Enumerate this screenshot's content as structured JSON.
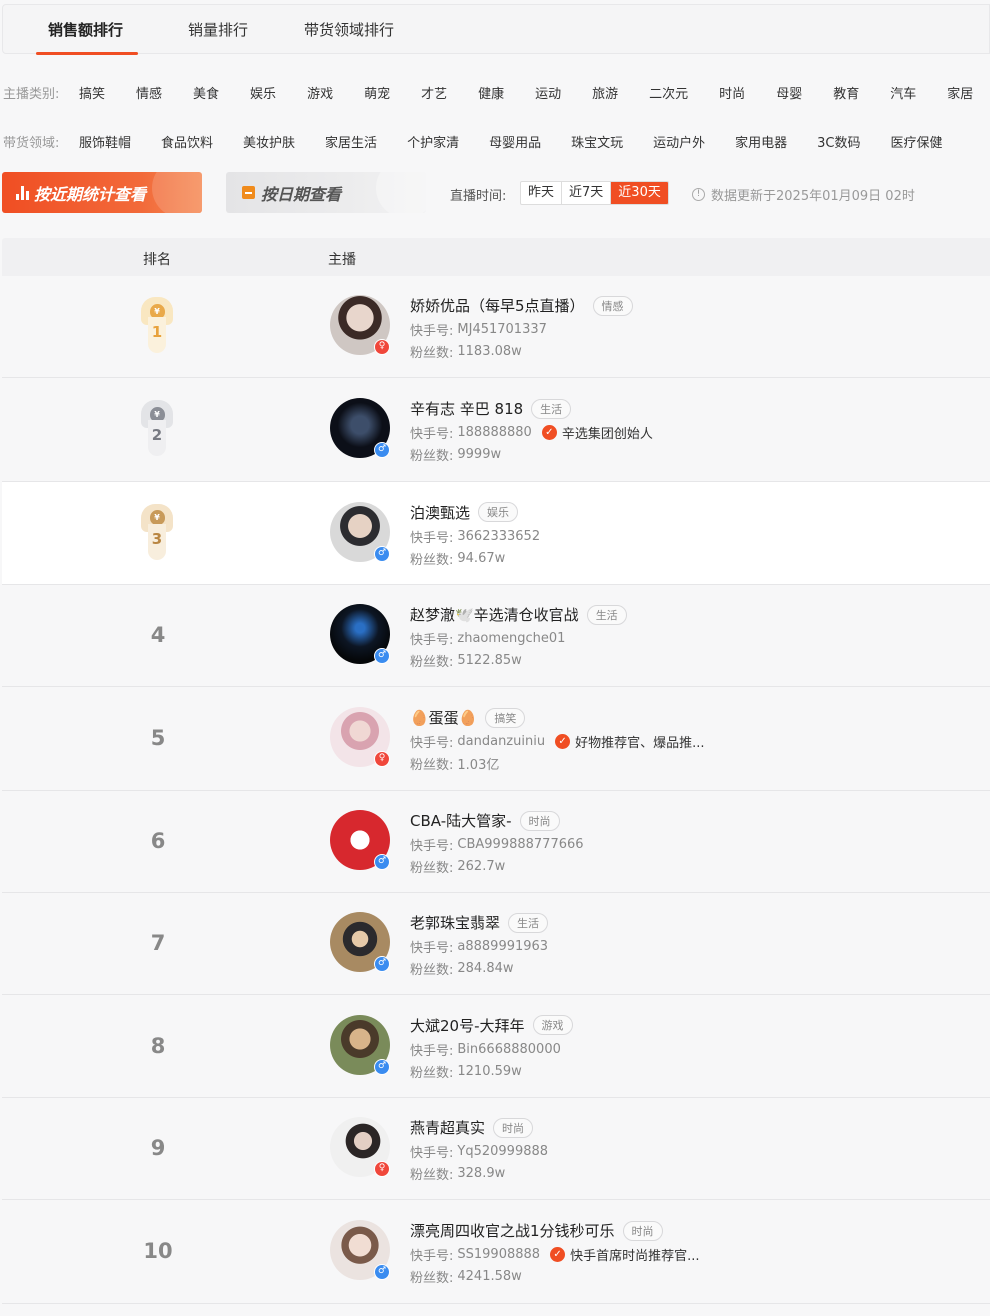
{
  "tabs": [
    "销售额排行",
    "销量排行",
    "带货领域排行"
  ],
  "filters": {
    "category_label": "主播类别:",
    "categories": [
      "搞笑",
      "情感",
      "美食",
      "娱乐",
      "游戏",
      "萌宠",
      "才艺",
      "健康",
      "运动",
      "旅游",
      "二次元",
      "时尚",
      "母婴",
      "教育",
      "汽车",
      "家居"
    ],
    "domain_label": "带货领域:",
    "domains": [
      "服饰鞋帽",
      "食品饮料",
      "美妆护肤",
      "家居生活",
      "个护家清",
      "母婴用品",
      "珠宝文玩",
      "运动户外",
      "家用电器",
      "3C数码",
      "医疗保健"
    ]
  },
  "toolbar": {
    "recent_btn": "按近期统计查看",
    "date_btn": "按日期查看",
    "time_label": "直播时间:",
    "ranges": [
      "昨天",
      "近7天",
      "近30天"
    ],
    "active_range": "近30天",
    "update_note": "数据更新于2025年01月09日 02时"
  },
  "table": {
    "headers": [
      "排名",
      "主播"
    ],
    "kuaishou_label": "快手号:",
    "fans_label": "粉丝数:",
    "rows": [
      {
        "rank": "1",
        "name": "娇娇优品（每早5点直播）",
        "tag": "情感",
        "id": "MJ451701337",
        "verify": "",
        "fans": "1183.08w",
        "gender": "♀"
      },
      {
        "rank": "2",
        "name": "辛有志 辛巴 818",
        "tag": "生活",
        "id": "188888880",
        "verify": "辛选集团创始人",
        "fans": "9999w",
        "gender": "♂"
      },
      {
        "rank": "3",
        "name": "泊澳甄选",
        "tag": "娱乐",
        "id": "3662333652",
        "verify": "",
        "fans": "94.67w",
        "gender": "♂"
      },
      {
        "rank": "4",
        "name": "赵梦澈🕊️辛选清仓收官战",
        "tag": "生活",
        "id": "zhaomengche01",
        "verify": "",
        "fans": "5122.85w",
        "gender": "♂"
      },
      {
        "rank": "5",
        "name": "🥚蛋蛋🥚",
        "tag": "搞笑",
        "id": "dandanzuiniu",
        "verify": "好物推荐官、爆品推...",
        "fans": "1.03亿",
        "gender": "♀"
      },
      {
        "rank": "6",
        "name": "CBA-陆大管家-",
        "tag": "时尚",
        "id": "CBA999888777666",
        "verify": "",
        "fans": "262.7w",
        "gender": "♂"
      },
      {
        "rank": "7",
        "name": "老郭珠宝翡翠",
        "tag": "生活",
        "id": "a8889991963",
        "verify": "",
        "fans": "284.84w",
        "gender": "♂"
      },
      {
        "rank": "8",
        "name": "大斌20号-大拜年",
        "tag": "游戏",
        "id": "Bin6668880000",
        "verify": "",
        "fans": "1210.59w",
        "gender": "♂"
      },
      {
        "rank": "9",
        "name": "燕青超真实",
        "tag": "时尚",
        "id": "Yq520999888",
        "verify": "",
        "fans": "328.9w",
        "gender": "♀"
      },
      {
        "rank": "10",
        "name": "漂亮周四收官之战1分钱秒可乐",
        "tag": "时尚",
        "id": "SS19908888",
        "verify": "快手首席时尚推荐官...",
        "fans": "4241.58w",
        "gender": "♂"
      }
    ]
  }
}
